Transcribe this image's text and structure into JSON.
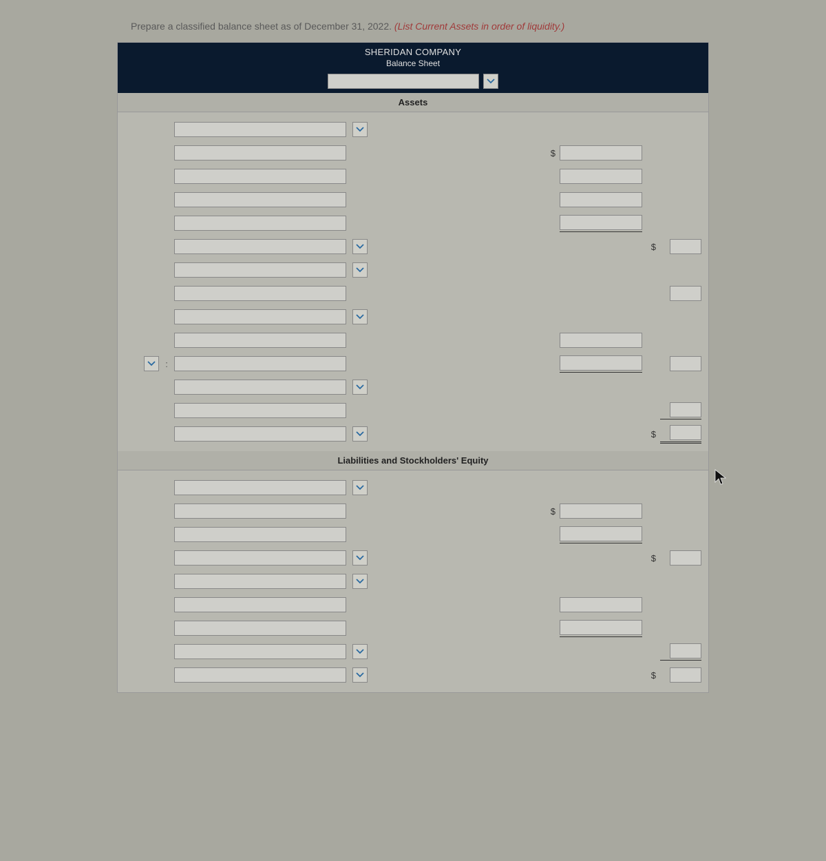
{
  "instruction_prefix": "Prepare a classified balance sheet as of December 31, 2022. ",
  "instruction_italic": "(List Current Assets in order of liquidity.)",
  "header": {
    "company": "SHERIDAN COMPANY",
    "doc": "Balance Sheet"
  },
  "sections": {
    "assets": "Assets",
    "liab_eq": "Liabilities and Stockholders' Equity"
  },
  "currency": "$"
}
